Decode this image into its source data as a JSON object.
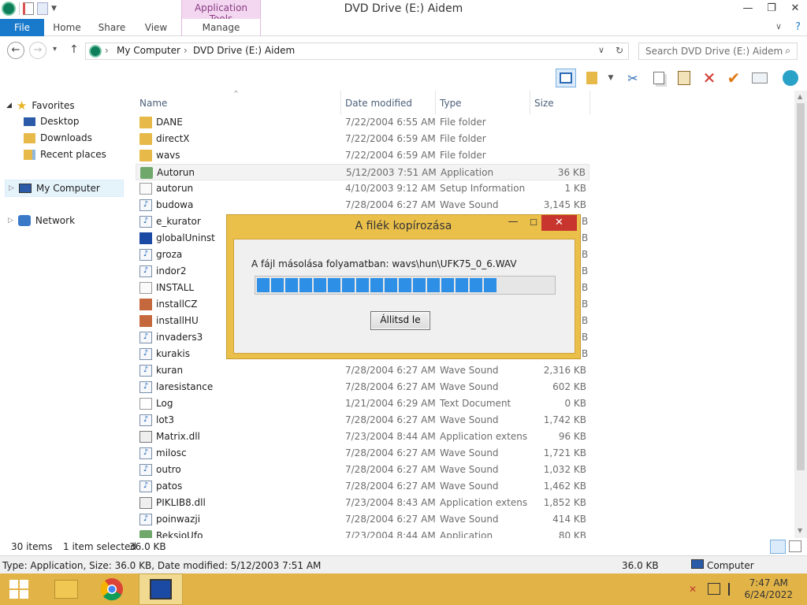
{
  "window": {
    "title": "DVD Drive (E:) Aidem",
    "app_tools_label": "Application Tools",
    "minimize": "—",
    "maximize": "❐",
    "close": "✕"
  },
  "ribbon": {
    "tabs": [
      "File",
      "Home",
      "Share",
      "View",
      "Manage"
    ],
    "help": "?",
    "expand": "∨"
  },
  "address": {
    "back": "←",
    "forward": "→",
    "recent": "▾",
    "up": "↑",
    "crumbs": [
      "My Computer",
      "DVD Drive (E:) Aidem"
    ],
    "separator": "›",
    "refresh": "↻",
    "dropdown": "∨",
    "search_placeholder": "Search DVD Drive (E:) Aidem"
  },
  "navpane": {
    "favorites": "Favorites",
    "desktop": "Desktop",
    "downloads": "Downloads",
    "recent_places": "Recent places",
    "my_computer": "My Computer",
    "network": "Network"
  },
  "columns": [
    "Name",
    "Date modified",
    "Type",
    "Size"
  ],
  "files": [
    {
      "name": "DANE",
      "date": "7/22/2004 6:55 AM",
      "type": "File folder",
      "size": "",
      "icon": "folder-icon"
    },
    {
      "name": "directX",
      "date": "7/22/2004 6:59 AM",
      "type": "File folder",
      "size": "",
      "icon": "folder-icon"
    },
    {
      "name": "wavs",
      "date": "7/22/2004 6:59 AM",
      "type": "File folder",
      "size": "",
      "icon": "folder-icon"
    },
    {
      "name": "Autorun",
      "date": "5/12/2003 7:51 AM",
      "type": "Application",
      "size": "36 KB",
      "icon": "application-icon"
    },
    {
      "name": "autorun",
      "date": "4/10/2003 9:12 AM",
      "type": "Setup Information",
      "size": "1 KB",
      "icon": "setup-info-icon"
    },
    {
      "name": "budowa",
      "date": "7/28/2004 6:27 AM",
      "type": "Wave Sound",
      "size": "3,145 KB",
      "icon": "wave-sound-icon"
    },
    {
      "name": "e_kurator",
      "date": "",
      "type": "",
      "size": "",
      "icon": "wave-sound-icon"
    },
    {
      "name": "globalUninst",
      "date": "",
      "type": "",
      "size": "",
      "icon": "uninstaller-icon"
    },
    {
      "name": "groza",
      "date": "",
      "type": "",
      "size": "",
      "icon": "wave-sound-icon"
    },
    {
      "name": "indor2",
      "date": "",
      "type": "",
      "size": "",
      "icon": "wave-sound-icon"
    },
    {
      "name": "INSTALL",
      "date": "",
      "type": "",
      "size": "",
      "icon": "setup-info-icon"
    },
    {
      "name": "installCZ",
      "date": "",
      "type": "",
      "size": "",
      "icon": "bitmap-image-icon"
    },
    {
      "name": "installHU",
      "date": "",
      "type": "",
      "size": "",
      "icon": "bitmap-image-icon"
    },
    {
      "name": "invaders3",
      "date": "",
      "type": "",
      "size": "",
      "icon": "wave-sound-icon"
    },
    {
      "name": "kurakis",
      "date": "",
      "type": "",
      "size": "",
      "icon": "wave-sound-icon"
    },
    {
      "name": "kuran",
      "date": "7/28/2004 6:27 AM",
      "type": "Wave Sound",
      "size": "2,316 KB",
      "icon": "wave-sound-icon"
    },
    {
      "name": "laresistance",
      "date": "7/28/2004 6:27 AM",
      "type": "Wave Sound",
      "size": "602 KB",
      "icon": "wave-sound-icon"
    },
    {
      "name": "Log",
      "date": "1/21/2004 6:29 AM",
      "type": "Text Document",
      "size": "0 KB",
      "icon": "text-document-icon"
    },
    {
      "name": "lot3",
      "date": "7/28/2004 6:27 AM",
      "type": "Wave Sound",
      "size": "1,742 KB",
      "icon": "wave-sound-icon"
    },
    {
      "name": "Matrix.dll",
      "date": "7/23/2004 8:44 AM",
      "type": "Application extens...",
      "size": "96 KB",
      "icon": "dll-icon"
    },
    {
      "name": "milosc",
      "date": "7/28/2004 6:27 AM",
      "type": "Wave Sound",
      "size": "1,721 KB",
      "icon": "wave-sound-icon"
    },
    {
      "name": "outro",
      "date": "7/28/2004 6:27 AM",
      "type": "Wave Sound",
      "size": "1,032 KB",
      "icon": "wave-sound-icon"
    },
    {
      "name": "patos",
      "date": "7/28/2004 6:27 AM",
      "type": "Wave Sound",
      "size": "1,462 KB",
      "icon": "wave-sound-icon"
    },
    {
      "name": "PIKLIB8.dll",
      "date": "7/23/2004 8:43 AM",
      "type": "Application extens...",
      "size": "1,852 KB",
      "icon": "dll-icon"
    },
    {
      "name": "poinwazji",
      "date": "7/28/2004 6:27 AM",
      "type": "Wave Sound",
      "size": "414 KB",
      "icon": "wave-sound-icon"
    },
    {
      "name": "ReksioUfo",
      "date": "7/23/2004 8:44 AM",
      "type": "Application",
      "size": "80 KB",
      "icon": "application-icon"
    }
  ],
  "selected_index": 3,
  "partial_sizes": [
    "B",
    "B",
    "B",
    "B",
    "B",
    "B",
    "B",
    "B",
    "B"
  ],
  "status": {
    "items": "30 items",
    "selected": "1 item selected",
    "selected_size": "36.0 KB"
  },
  "details": {
    "summary": "Type: Application, Size: 36.0 KB, Date modified: 5/12/2003 7:51 AM",
    "size": "36.0 KB",
    "location": "Computer"
  },
  "dialog": {
    "title": "A filék kopírozása",
    "minimize": "—",
    "maximize": "☐",
    "close": "✕",
    "message": "A fájl másolása folyamatban: wavs\\hun\\UFK75_0_6.WAV",
    "progress_fraction": 0.84,
    "progress_segments": 20,
    "stop_label": "Állitsd le"
  },
  "clock": {
    "time": "7:47 AM",
    "date": "6/24/2022"
  },
  "colors": {
    "accent": "#1979ca",
    "progress": "#2d8fe6",
    "taskbar": "#e2b448",
    "dialog_frame": "#ebc04a",
    "close_red": "#c7352e"
  }
}
